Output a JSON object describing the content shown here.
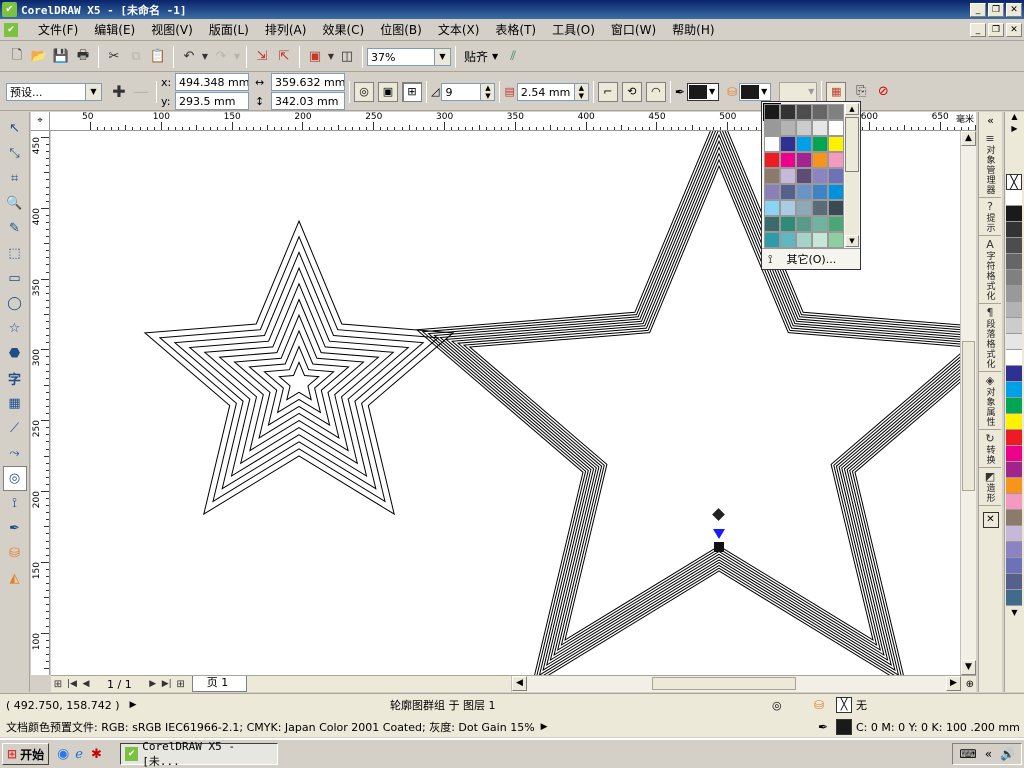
{
  "window": {
    "title": "CorelDRAW X5 - [未命名 -1]"
  },
  "menu": [
    "文件(F)",
    "编辑(E)",
    "视图(V)",
    "版面(L)",
    "排列(A)",
    "效果(C)",
    "位图(B)",
    "文本(X)",
    "表格(T)",
    "工具(O)",
    "窗口(W)",
    "帮助(H)"
  ],
  "toolbar": {
    "zoom": "37%",
    "snap_label": "贴齐"
  },
  "propbar": {
    "preset": "预设...",
    "x_label": "x:",
    "x": "494.348 mm",
    "y_label": "y:",
    "y": "293.5 mm",
    "w": "359.632 mm",
    "h": "342.03 mm",
    "steps": "9",
    "offset": "2.54 mm",
    "outline_color": "#1a1a1a",
    "fill_color": "#1a1a1a"
  },
  "ruler": {
    "unit": "毫米",
    "h_ticks": [
      "50",
      "100",
      "150",
      "200",
      "250",
      "300",
      "350",
      "400",
      "450",
      "500",
      "550",
      "600",
      "650"
    ],
    "v_ticks": [
      "450",
      "400",
      "350",
      "300",
      "250",
      "200",
      "150",
      "100"
    ]
  },
  "color_popup": {
    "other_label": "其它(O)...",
    "swatches": [
      "#1a1a1a",
      "#333333",
      "#4d4d4d",
      "#666666",
      "#808080",
      "#999999",
      "#b3b3b3",
      "#cccccc",
      "#e6e6e6",
      "#ffffff",
      "#ffffff",
      "#2e3192",
      "#00a0e9",
      "#00a651",
      "#fff200",
      "#ed1c24",
      "#ec008c",
      "#a3238e",
      "#f7941d",
      "#f49ac1",
      "#8c7a6b",
      "#c5b8d9",
      "#5c4b75",
      "#8b83c2",
      "#6d71b8",
      "#8b7fb8",
      "#56608c",
      "#6c93c6",
      "#3f84c6",
      "#0093dd",
      "#8bd3f4",
      "#a9cde0",
      "#8fa8b8",
      "#5b6c78",
      "#3a4a55",
      "#3d6b6b",
      "#2e8b7a",
      "#5a9a88",
      "#6fb3a0",
      "#4aa876",
      "#2e9ba8",
      "#5fb7c0",
      "#a6d3c8",
      "#c6e6d8",
      "#8fcf9f"
    ]
  },
  "statusbar": {
    "coords": "( 492.750, 158.742 )",
    "selection": "轮廓图群组 于 图层 1",
    "fill_none": "无",
    "profile": "文档颜色预置文件: RGB: sRGB IEC61966-2.1; CMYK: Japan Color 2001 Coated; 灰度: Dot Gain 15%",
    "outline_info": "C: 0 M: 0 Y: 0 K: 100  .200 mm"
  },
  "page_nav": {
    "count": "1 / 1",
    "tab": "页 1"
  },
  "dockers": [
    {
      "name": "docker-object-manager",
      "label": "对象管理器",
      "icon": "≡"
    },
    {
      "name": "docker-hints",
      "label": "提示",
      "icon": "?"
    },
    {
      "name": "docker-char-format",
      "label": "字符格式化",
      "icon": "A"
    },
    {
      "name": "docker-para-format",
      "label": "段落格式化",
      "icon": "¶"
    },
    {
      "name": "docker-object-props",
      "label": "对象属性",
      "icon": "◈"
    },
    {
      "name": "docker-transform",
      "label": "转换",
      "icon": "↻"
    },
    {
      "name": "docker-shaping",
      "label": "造形",
      "icon": "◩"
    }
  ],
  "palette": [
    "#ffffff",
    "#1a1a1a",
    "#333333",
    "#4d4d4d",
    "#666666",
    "#808080",
    "#999999",
    "#b3b3b3",
    "#cccccc",
    "#e6e6e6",
    "#ffffff",
    "#2e3192",
    "#00a0e9",
    "#00a651",
    "#fff200",
    "#ed1c24",
    "#ec008c",
    "#a3238e",
    "#f7941d",
    "#f49ac1",
    "#8c7a6b",
    "#c5b8d9",
    "#8b83c2",
    "#6d71b8",
    "#56608c",
    "#3f6b8c"
  ],
  "taskbar": {
    "start": "开始",
    "task": "CorelDRAW X5 - [未..."
  }
}
